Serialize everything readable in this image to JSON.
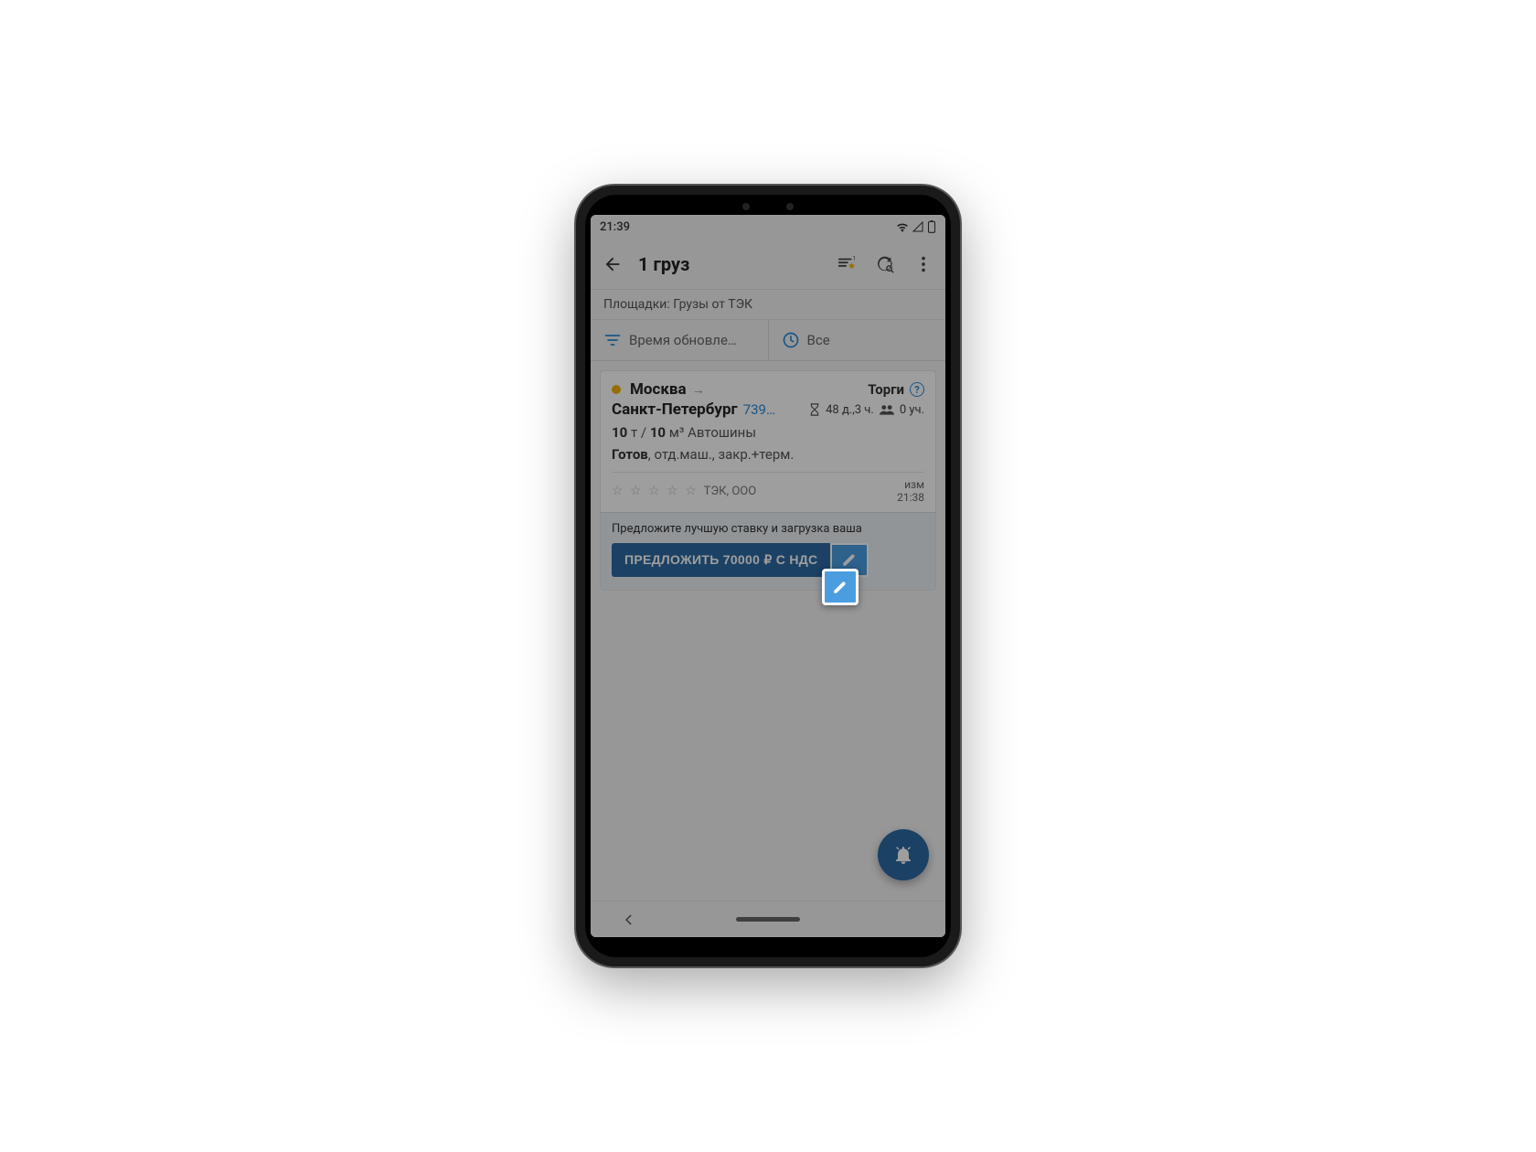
{
  "status": {
    "time": "21:39"
  },
  "header": {
    "title": "1 груз"
  },
  "sub_bar": {
    "text": "Площадки: Грузы от ТЭК"
  },
  "filters": {
    "sort_label": "Время обновле…",
    "time_label": "Все"
  },
  "card": {
    "origin": "Москва",
    "destination": "Санкт-Петербург",
    "distance": "739…",
    "auction_label": "Торги",
    "time_left": "48 д.,3 ч.",
    "participants": "0 уч.",
    "weight": "10",
    "weight_unit": "т",
    "volume": "10",
    "volume_unit": "м³",
    "cargo_type": "Автошины",
    "status": "Готов",
    "conditions": ", отд.маш., закр.+терм.",
    "company": "ТЭК, ООО",
    "changed_label": "изм",
    "changed_time": "21:38"
  },
  "bid": {
    "hint": "Предложите лучшую ставку и загрузка ваша",
    "button": "ПРЕДЛОЖИТЬ 70000 ₽ С НДС"
  }
}
